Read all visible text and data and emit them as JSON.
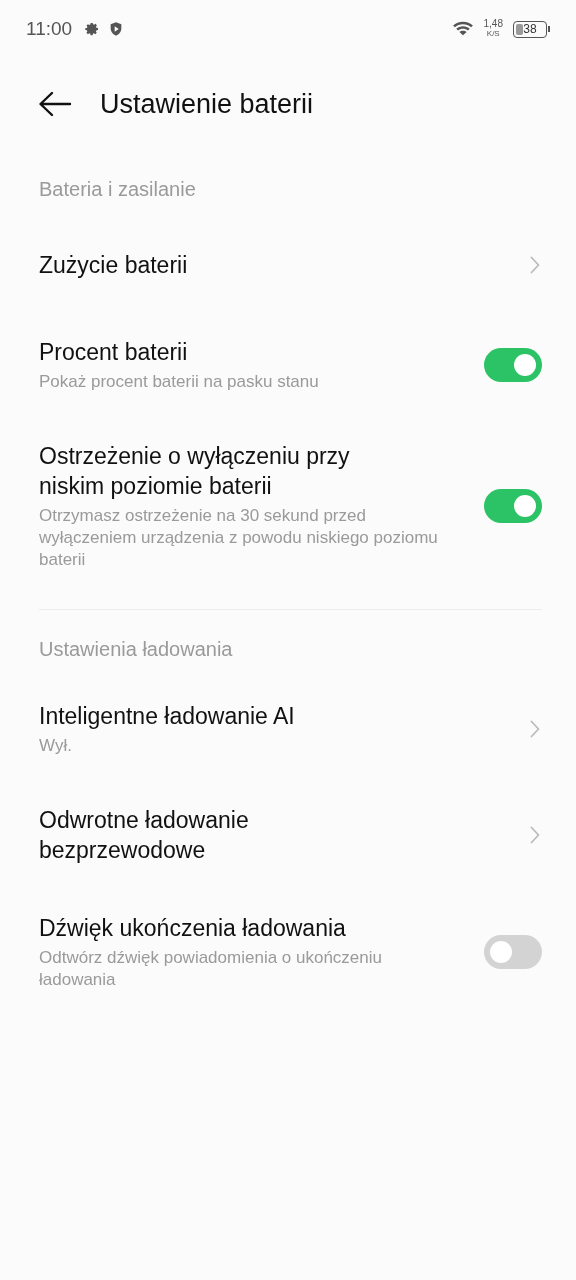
{
  "status_bar": {
    "time": "11:00",
    "speed_value": "1,48",
    "speed_unit": "K/S",
    "battery": "38"
  },
  "header": {
    "title": "Ustawienie baterii"
  },
  "sections": [
    {
      "title": "Bateria i zasilanie",
      "items": [
        {
          "kind": "link",
          "title": "Zużycie baterii"
        },
        {
          "kind": "toggle",
          "title": "Procent baterii",
          "subtitle": "Pokaż procent baterii na pasku stanu",
          "on": true
        },
        {
          "kind": "toggle",
          "title": "Ostrzeżenie o wyłączeniu przy niskim poziomie baterii",
          "subtitle": "Otrzymasz ostrzeżenie na 30 sekund przed wyłączeniem urządzenia z powodu niskiego poziomu baterii",
          "on": true
        }
      ]
    },
    {
      "title": "Ustawienia ładowania",
      "items": [
        {
          "kind": "link",
          "title": "Inteligentne ładowanie AI",
          "subtitle": "Wył."
        },
        {
          "kind": "link",
          "title": "Odwrotne ładowanie bezprzewodowe"
        },
        {
          "kind": "toggle",
          "title": "Dźwięk ukończenia ładowania",
          "subtitle": "Odtwórz dźwięk powiadomienia o ukończeniu ładowania",
          "on": false
        }
      ]
    }
  ]
}
